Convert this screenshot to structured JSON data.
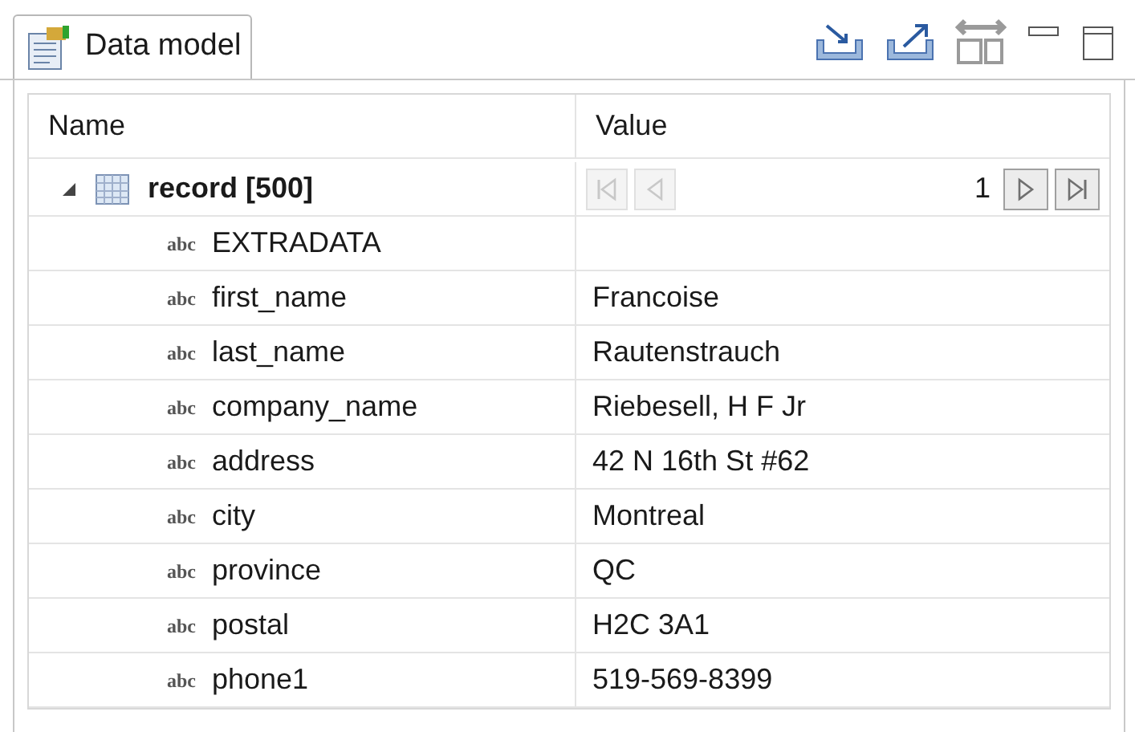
{
  "view_tab": {
    "title": "Data model",
    "selected": true
  },
  "table": {
    "columns": [
      "Name",
      "Value"
    ],
    "record": {
      "name": "record [500]",
      "expanded": true,
      "page": "1",
      "nav": [
        {
          "kind": "first",
          "disabled": true
        },
        {
          "kind": "prev",
          "disabled": true
        },
        {
          "kind": "next",
          "disabled": false
        },
        {
          "kind": "last",
          "disabled": false
        }
      ]
    },
    "fields": [
      {
        "type": "abc",
        "name": "EXTRADATA"
      },
      {
        "type": "abc",
        "name": "first_name",
        "value": "Francoise"
      },
      {
        "type": "abc",
        "name": "last_name",
        "value": "Rautenstrauch"
      },
      {
        "type": "abc",
        "name": "company_name",
        "value": "Riebesell, H F Jr"
      },
      {
        "type": "abc",
        "name": "address",
        "value": "42 N 16th St #62"
      },
      {
        "type": "abc",
        "name": "city",
        "value": "Montreal"
      },
      {
        "type": "abc",
        "name": "province",
        "value": "QC"
      },
      {
        "type": "abc",
        "name": "postal",
        "value": "H2C 3A1"
      },
      {
        "type": "abc",
        "name": "phone1",
        "value": "519-569-8399"
      }
    ]
  }
}
